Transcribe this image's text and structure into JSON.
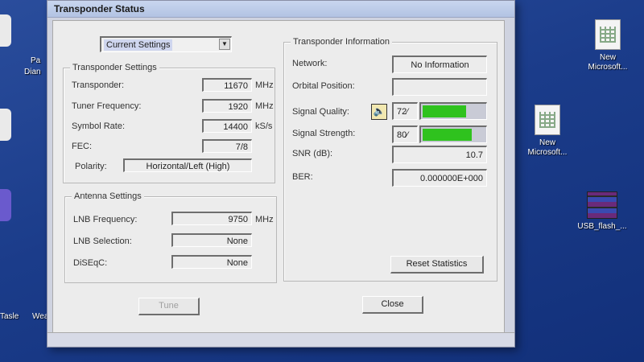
{
  "desktop": {
    "icons": [
      {
        "label": "New\nMicrosoft..."
      },
      {
        "label": "New\nMicrosoft..."
      },
      {
        "label": "USB_flash_..."
      }
    ],
    "left_labels": [
      "Pa",
      "Dian",
      "Tasle",
      "Wea"
    ]
  },
  "dialog": {
    "title": "Transponder Status",
    "view_combo": {
      "value": "Current Settings"
    },
    "transponder_settings": {
      "title": "Transponder Settings",
      "rows": [
        {
          "label": "Transponder:",
          "value": "11670",
          "unit": "MHz"
        },
        {
          "label": "Tuner Frequency:",
          "value": "1920",
          "unit": "MHz"
        },
        {
          "label": "Symbol Rate:",
          "value": "14400",
          "unit": "kS/s"
        },
        {
          "label": "FEC:",
          "value": "7/8",
          "unit": ""
        }
      ],
      "polarity_label": "Polarity:",
      "polarity_value": "Horizontal/Left (High)"
    },
    "antenna_settings": {
      "title": "Antenna Settings",
      "rows": [
        {
          "label": "LNB Frequency:",
          "value": "9750",
          "unit": "MHz"
        },
        {
          "label": "LNB Selection:",
          "value": "None",
          "unit": ""
        },
        {
          "label": "DiSEqC:",
          "value": "None",
          "unit": ""
        }
      ]
    },
    "transponder_information": {
      "title": "Transponder Information",
      "network_label": "Network:",
      "network_value": "No Information",
      "orbital_label": "Orbital Position:",
      "orbital_value": "",
      "signal_quality_label": "Signal Quality:",
      "signal_quality_value": "72⁄",
      "signal_quality_level": 0.72,
      "signal_strength_label": "Signal Strength:",
      "signal_strength_value": "80⁄",
      "signal_strength_level": 0.8,
      "snr_label": "SNR (dB):",
      "snr_value": "10.7",
      "ber_label": "BER:",
      "ber_value": "0.000000E+000",
      "reset_label": "Reset Statistics"
    },
    "buttons": {
      "tune": "Tune",
      "close": "Close"
    },
    "accent_green": "#2fc21e"
  }
}
